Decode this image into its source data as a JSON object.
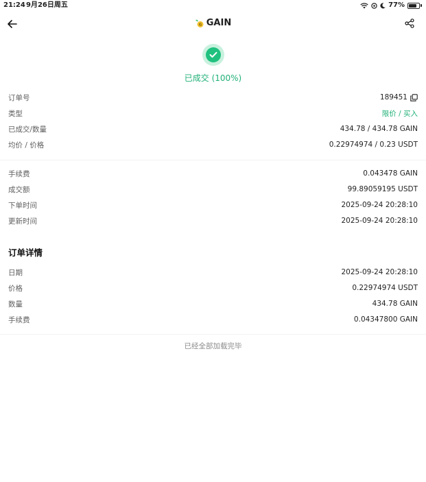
{
  "status_bar": {
    "time": "21:24",
    "date": "9月26日周五",
    "battery": "77%",
    "battery_level": 0.77
  },
  "nav": {
    "title": "GAIN",
    "back_icon": "arrow-left-icon",
    "share_icon": "share-icon"
  },
  "order_status": {
    "text": "已成交 (100%)",
    "color": "#20b178"
  },
  "summary": {
    "order_no_label": "订单号",
    "order_no_value": "189451",
    "type_label": "类型",
    "type_value": "限价 / 买入",
    "filled_label": "已成交/数量",
    "filled_value": "434.78 / 434.78 GAIN",
    "avg_price_label": "均价 / 价格",
    "avg_price_value": "0.22974974 / 0.23 USDT"
  },
  "fees": {
    "fee_label": "手续费",
    "fee_value": "0.043478 GAIN",
    "amount_label": "成交额",
    "amount_value": "99.89059195 USDT",
    "order_time_label": "下单时间",
    "order_time_value": "2025-09-24 20:28:10",
    "update_time_label": "更新时间",
    "update_time_value": "2025-09-24 20:28:10"
  },
  "details": {
    "title": "订单详情",
    "date_label": "日期",
    "date_value": "2025-09-24 20:28:10",
    "price_label": "价格",
    "price_value": "0.22974974 USDT",
    "qty_label": "数量",
    "qty_value": "434.78 GAIN",
    "fee_label": "手续费",
    "fee_value": "0.04347800 GAIN"
  },
  "footer": {
    "loaded_text": "已经全部加载完毕"
  }
}
